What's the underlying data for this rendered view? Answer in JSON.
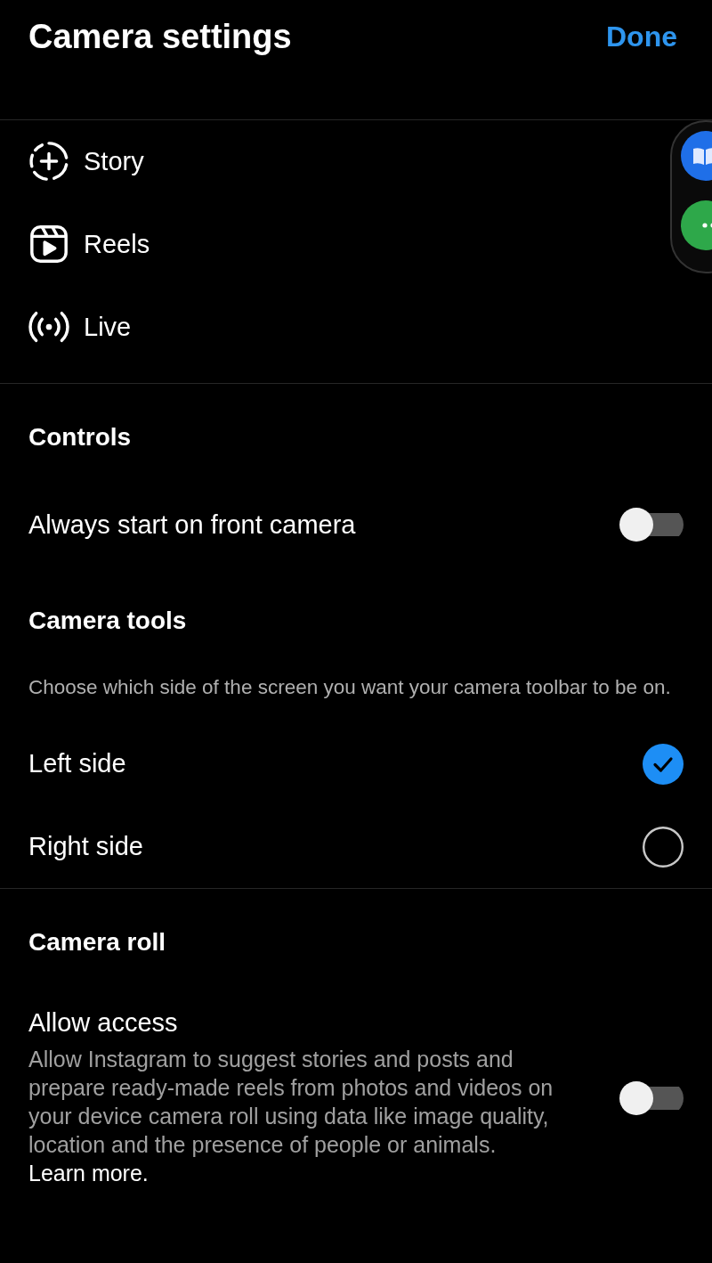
{
  "header": {
    "title": "Camera settings",
    "done": "Done"
  },
  "modes": [
    {
      "kind": "story",
      "label": "Story"
    },
    {
      "kind": "reels",
      "label": "Reels"
    },
    {
      "kind": "live",
      "label": "Live"
    }
  ],
  "controls": {
    "heading": "Controls",
    "toggles": [
      {
        "label": "Always start on front camera",
        "on": false
      }
    ]
  },
  "camera_tools": {
    "heading": "Camera tools",
    "description": "Choose which side of the screen you want your camera toolbar to be on.",
    "options": [
      {
        "label": "Left side",
        "selected": true
      },
      {
        "label": "Right side",
        "selected": false
      }
    ]
  },
  "camera_roll": {
    "heading": "Camera roll",
    "setting": {
      "label": "Allow access",
      "description": "Allow Instagram to suggest stories and posts and prepare ready-made reels from photos and videos on your device camera roll using data like image quality, location and the presence of people or animals.",
      "link": "Learn more.",
      "on": false
    }
  }
}
